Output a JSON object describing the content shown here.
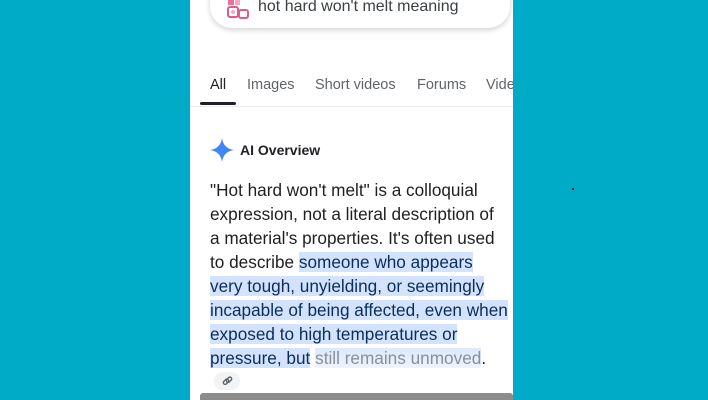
{
  "search": {
    "query": "hot hard won't melt meaning",
    "lens_icon": "google-lens-icon"
  },
  "tabs": [
    {
      "label": "All",
      "active": true
    },
    {
      "label": "Images"
    },
    {
      "label": "Short videos"
    },
    {
      "label": "Forums"
    },
    {
      "label": "Vide"
    }
  ],
  "ai_overview": {
    "title": "AI Overview",
    "icon": "gemini-sparkle-icon",
    "text_plain": "\"Hot hard won't melt\" is a colloquial expression, not a literal description of a material's properties. It's often used to describe",
    "text_highlighted": "someone who appears very tough, unyielding, or seemingly incapable of being affected, even when exposed to high temperatures or pressure, but",
    "text_faded": "still remains unmoved",
    "text_end": ".",
    "link_icon": "link-icon"
  },
  "colors": {
    "background": "#00abc8",
    "highlight": "#d3e3fd",
    "sparkle": "#4285f4"
  }
}
